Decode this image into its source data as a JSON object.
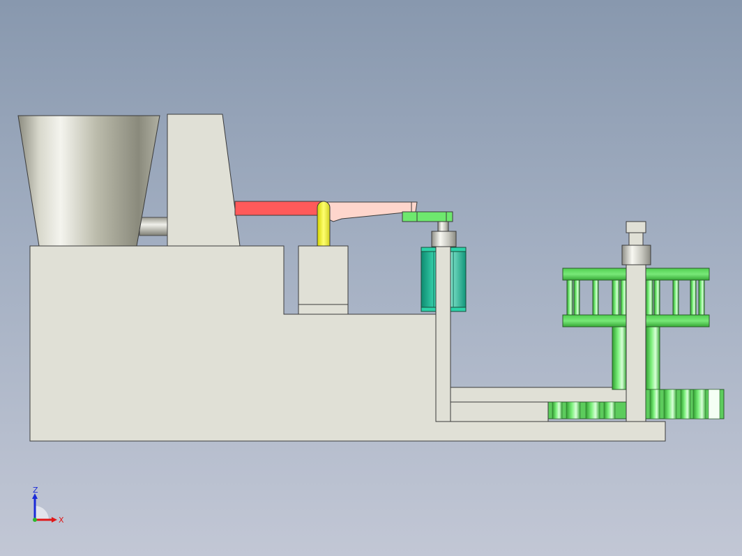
{
  "model_view": {
    "background_top": "#8898ae",
    "background_bottom": "#c2c7d5",
    "part_colors": {
      "frame": "#e0e0d6",
      "hopper": "#bcbcac",
      "red_arm": "#ff5a5a",
      "pink_arm": "#ffd0c8",
      "yellow_link": "#f0f050",
      "green_parts": "#55d855",
      "teal_cylinder": "#22c8a0",
      "bushing": "#d8d8d0"
    },
    "components": [
      "hopper",
      "upright-block",
      "base-frame",
      "red-arm",
      "pink-arm",
      "yellow-link",
      "green-lever",
      "teal-cylinder",
      "vertical-post",
      "green-wheel",
      "green-gear"
    ]
  },
  "triad": {
    "z_label": "Z",
    "x_label": "X",
    "z_color": "#1a2ad8",
    "x_color": "#e01818"
  }
}
